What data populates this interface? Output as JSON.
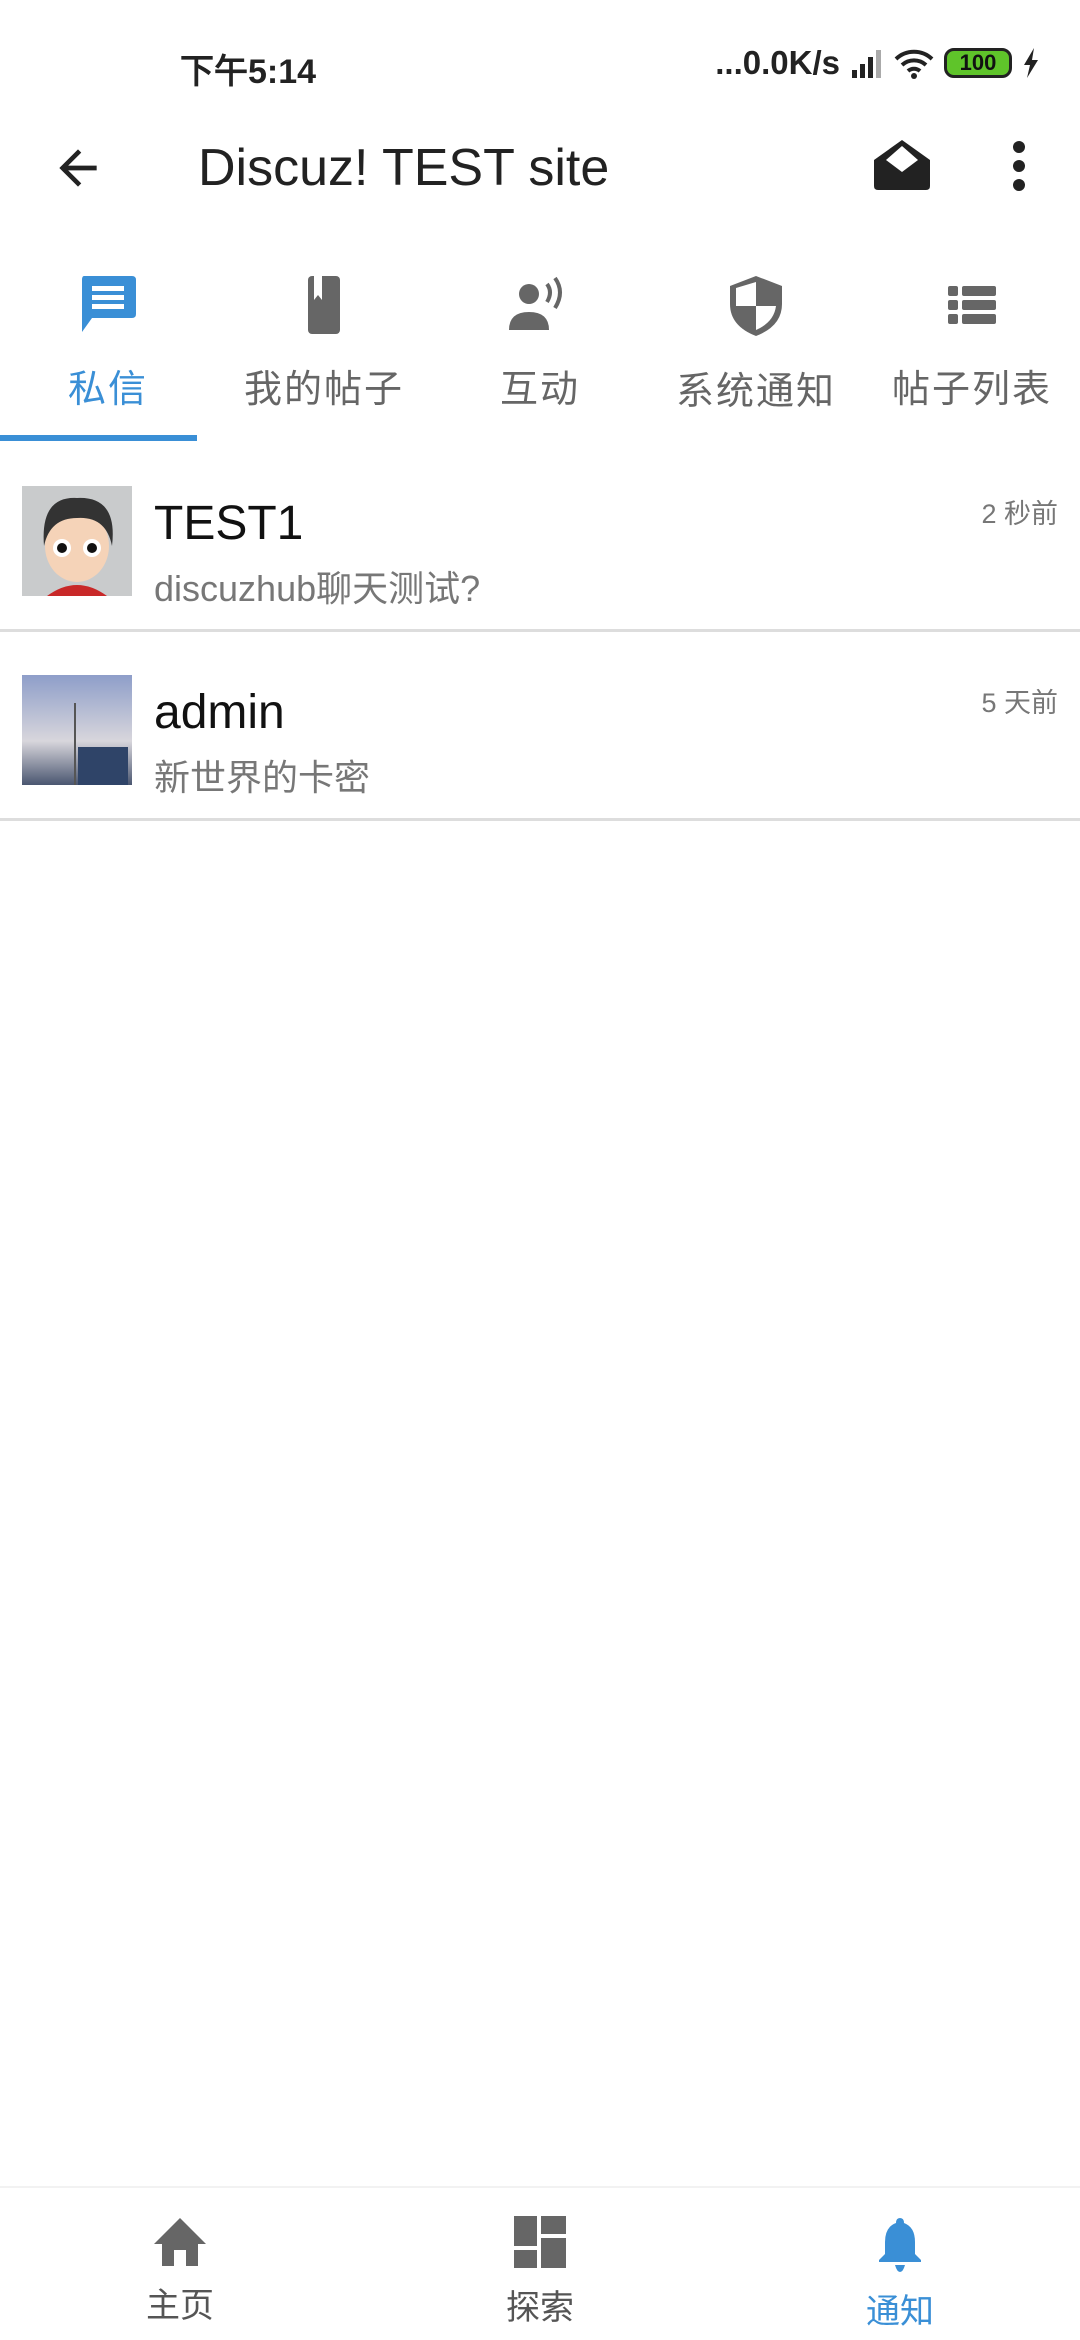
{
  "status_bar": {
    "time": "下午5:14",
    "network_speed": "...0.0K/s",
    "battery": "100"
  },
  "toolbar": {
    "title": "Discuz! TEST site",
    "back_icon": "arrow-left-icon",
    "mail_icon": "envelope-open-icon",
    "more_icon": "more-vertical-icon"
  },
  "tabs": [
    {
      "label": "私信",
      "icon": "chat-icon",
      "active": true
    },
    {
      "label": "我的帖子",
      "icon": "bookmark-book-icon"
    },
    {
      "label": "互动",
      "icon": "person-voice-icon"
    },
    {
      "label": "系统通知",
      "icon": "shield-icon"
    },
    {
      "label": "帖子列表",
      "icon": "list-icon"
    }
  ],
  "messages": [
    {
      "name": "TEST1",
      "preview": "discuzhub聊天测试?",
      "time": "2 秒前"
    },
    {
      "name": "admin",
      "preview": "新世界的卡密",
      "time": "5 天前"
    }
  ],
  "bottom_nav": [
    {
      "label": "主页",
      "icon": "home-icon"
    },
    {
      "label": "探索",
      "icon": "dashboard-icon"
    },
    {
      "label": "通知",
      "icon": "bell-icon",
      "active": true
    }
  ],
  "colors": {
    "accent": "#3a8fd6",
    "icon_gray": "#666666"
  }
}
